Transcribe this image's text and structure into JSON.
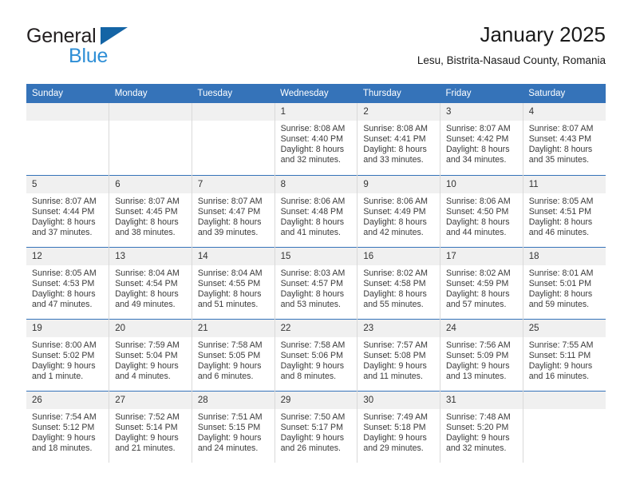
{
  "brand": {
    "name_part1": "General",
    "name_part2": "Blue",
    "triangle_icon": "triangle-logo-icon",
    "colors": {
      "dark": "#231f20",
      "blue": "#2f8fd6",
      "triangle": "#1464a5"
    }
  },
  "header": {
    "title": "January 2025",
    "subtitle": "Lesu, Bistrita-Nasaud County, Romania"
  },
  "calendar": {
    "header_bg": "#3573b9",
    "daynum_bg": "#f0f0f0",
    "weekdays": [
      "Sunday",
      "Monday",
      "Tuesday",
      "Wednesday",
      "Thursday",
      "Friday",
      "Saturday"
    ],
    "weeks": [
      [
        {
          "day": "",
          "lines": []
        },
        {
          "day": "",
          "lines": []
        },
        {
          "day": "",
          "lines": []
        },
        {
          "day": "1",
          "lines": [
            "Sunrise: 8:08 AM",
            "Sunset: 4:40 PM",
            "Daylight: 8 hours",
            "and 32 minutes."
          ]
        },
        {
          "day": "2",
          "lines": [
            "Sunrise: 8:08 AM",
            "Sunset: 4:41 PM",
            "Daylight: 8 hours",
            "and 33 minutes."
          ]
        },
        {
          "day": "3",
          "lines": [
            "Sunrise: 8:07 AM",
            "Sunset: 4:42 PM",
            "Daylight: 8 hours",
            "and 34 minutes."
          ]
        },
        {
          "day": "4",
          "lines": [
            "Sunrise: 8:07 AM",
            "Sunset: 4:43 PM",
            "Daylight: 8 hours",
            "and 35 minutes."
          ]
        }
      ],
      [
        {
          "day": "5",
          "lines": [
            "Sunrise: 8:07 AM",
            "Sunset: 4:44 PM",
            "Daylight: 8 hours",
            "and 37 minutes."
          ]
        },
        {
          "day": "6",
          "lines": [
            "Sunrise: 8:07 AM",
            "Sunset: 4:45 PM",
            "Daylight: 8 hours",
            "and 38 minutes."
          ]
        },
        {
          "day": "7",
          "lines": [
            "Sunrise: 8:07 AM",
            "Sunset: 4:47 PM",
            "Daylight: 8 hours",
            "and 39 minutes."
          ]
        },
        {
          "day": "8",
          "lines": [
            "Sunrise: 8:06 AM",
            "Sunset: 4:48 PM",
            "Daylight: 8 hours",
            "and 41 minutes."
          ]
        },
        {
          "day": "9",
          "lines": [
            "Sunrise: 8:06 AM",
            "Sunset: 4:49 PM",
            "Daylight: 8 hours",
            "and 42 minutes."
          ]
        },
        {
          "day": "10",
          "lines": [
            "Sunrise: 8:06 AM",
            "Sunset: 4:50 PM",
            "Daylight: 8 hours",
            "and 44 minutes."
          ]
        },
        {
          "day": "11",
          "lines": [
            "Sunrise: 8:05 AM",
            "Sunset: 4:51 PM",
            "Daylight: 8 hours",
            "and 46 minutes."
          ]
        }
      ],
      [
        {
          "day": "12",
          "lines": [
            "Sunrise: 8:05 AM",
            "Sunset: 4:53 PM",
            "Daylight: 8 hours",
            "and 47 minutes."
          ]
        },
        {
          "day": "13",
          "lines": [
            "Sunrise: 8:04 AM",
            "Sunset: 4:54 PM",
            "Daylight: 8 hours",
            "and 49 minutes."
          ]
        },
        {
          "day": "14",
          "lines": [
            "Sunrise: 8:04 AM",
            "Sunset: 4:55 PM",
            "Daylight: 8 hours",
            "and 51 minutes."
          ]
        },
        {
          "day": "15",
          "lines": [
            "Sunrise: 8:03 AM",
            "Sunset: 4:57 PM",
            "Daylight: 8 hours",
            "and 53 minutes."
          ]
        },
        {
          "day": "16",
          "lines": [
            "Sunrise: 8:02 AM",
            "Sunset: 4:58 PM",
            "Daylight: 8 hours",
            "and 55 minutes."
          ]
        },
        {
          "day": "17",
          "lines": [
            "Sunrise: 8:02 AM",
            "Sunset: 4:59 PM",
            "Daylight: 8 hours",
            "and 57 minutes."
          ]
        },
        {
          "day": "18",
          "lines": [
            "Sunrise: 8:01 AM",
            "Sunset: 5:01 PM",
            "Daylight: 8 hours",
            "and 59 minutes."
          ]
        }
      ],
      [
        {
          "day": "19",
          "lines": [
            "Sunrise: 8:00 AM",
            "Sunset: 5:02 PM",
            "Daylight: 9 hours",
            "and 1 minute."
          ]
        },
        {
          "day": "20",
          "lines": [
            "Sunrise: 7:59 AM",
            "Sunset: 5:04 PM",
            "Daylight: 9 hours",
            "and 4 minutes."
          ]
        },
        {
          "day": "21",
          "lines": [
            "Sunrise: 7:58 AM",
            "Sunset: 5:05 PM",
            "Daylight: 9 hours",
            "and 6 minutes."
          ]
        },
        {
          "day": "22",
          "lines": [
            "Sunrise: 7:58 AM",
            "Sunset: 5:06 PM",
            "Daylight: 9 hours",
            "and 8 minutes."
          ]
        },
        {
          "day": "23",
          "lines": [
            "Sunrise: 7:57 AM",
            "Sunset: 5:08 PM",
            "Daylight: 9 hours",
            "and 11 minutes."
          ]
        },
        {
          "day": "24",
          "lines": [
            "Sunrise: 7:56 AM",
            "Sunset: 5:09 PM",
            "Daylight: 9 hours",
            "and 13 minutes."
          ]
        },
        {
          "day": "25",
          "lines": [
            "Sunrise: 7:55 AM",
            "Sunset: 5:11 PM",
            "Daylight: 9 hours",
            "and 16 minutes."
          ]
        }
      ],
      [
        {
          "day": "26",
          "lines": [
            "Sunrise: 7:54 AM",
            "Sunset: 5:12 PM",
            "Daylight: 9 hours",
            "and 18 minutes."
          ]
        },
        {
          "day": "27",
          "lines": [
            "Sunrise: 7:52 AM",
            "Sunset: 5:14 PM",
            "Daylight: 9 hours",
            "and 21 minutes."
          ]
        },
        {
          "day": "28",
          "lines": [
            "Sunrise: 7:51 AM",
            "Sunset: 5:15 PM",
            "Daylight: 9 hours",
            "and 24 minutes."
          ]
        },
        {
          "day": "29",
          "lines": [
            "Sunrise: 7:50 AM",
            "Sunset: 5:17 PM",
            "Daylight: 9 hours",
            "and 26 minutes."
          ]
        },
        {
          "day": "30",
          "lines": [
            "Sunrise: 7:49 AM",
            "Sunset: 5:18 PM",
            "Daylight: 9 hours",
            "and 29 minutes."
          ]
        },
        {
          "day": "31",
          "lines": [
            "Sunrise: 7:48 AM",
            "Sunset: 5:20 PM",
            "Daylight: 9 hours",
            "and 32 minutes."
          ]
        },
        {
          "day": "",
          "lines": []
        }
      ]
    ]
  }
}
